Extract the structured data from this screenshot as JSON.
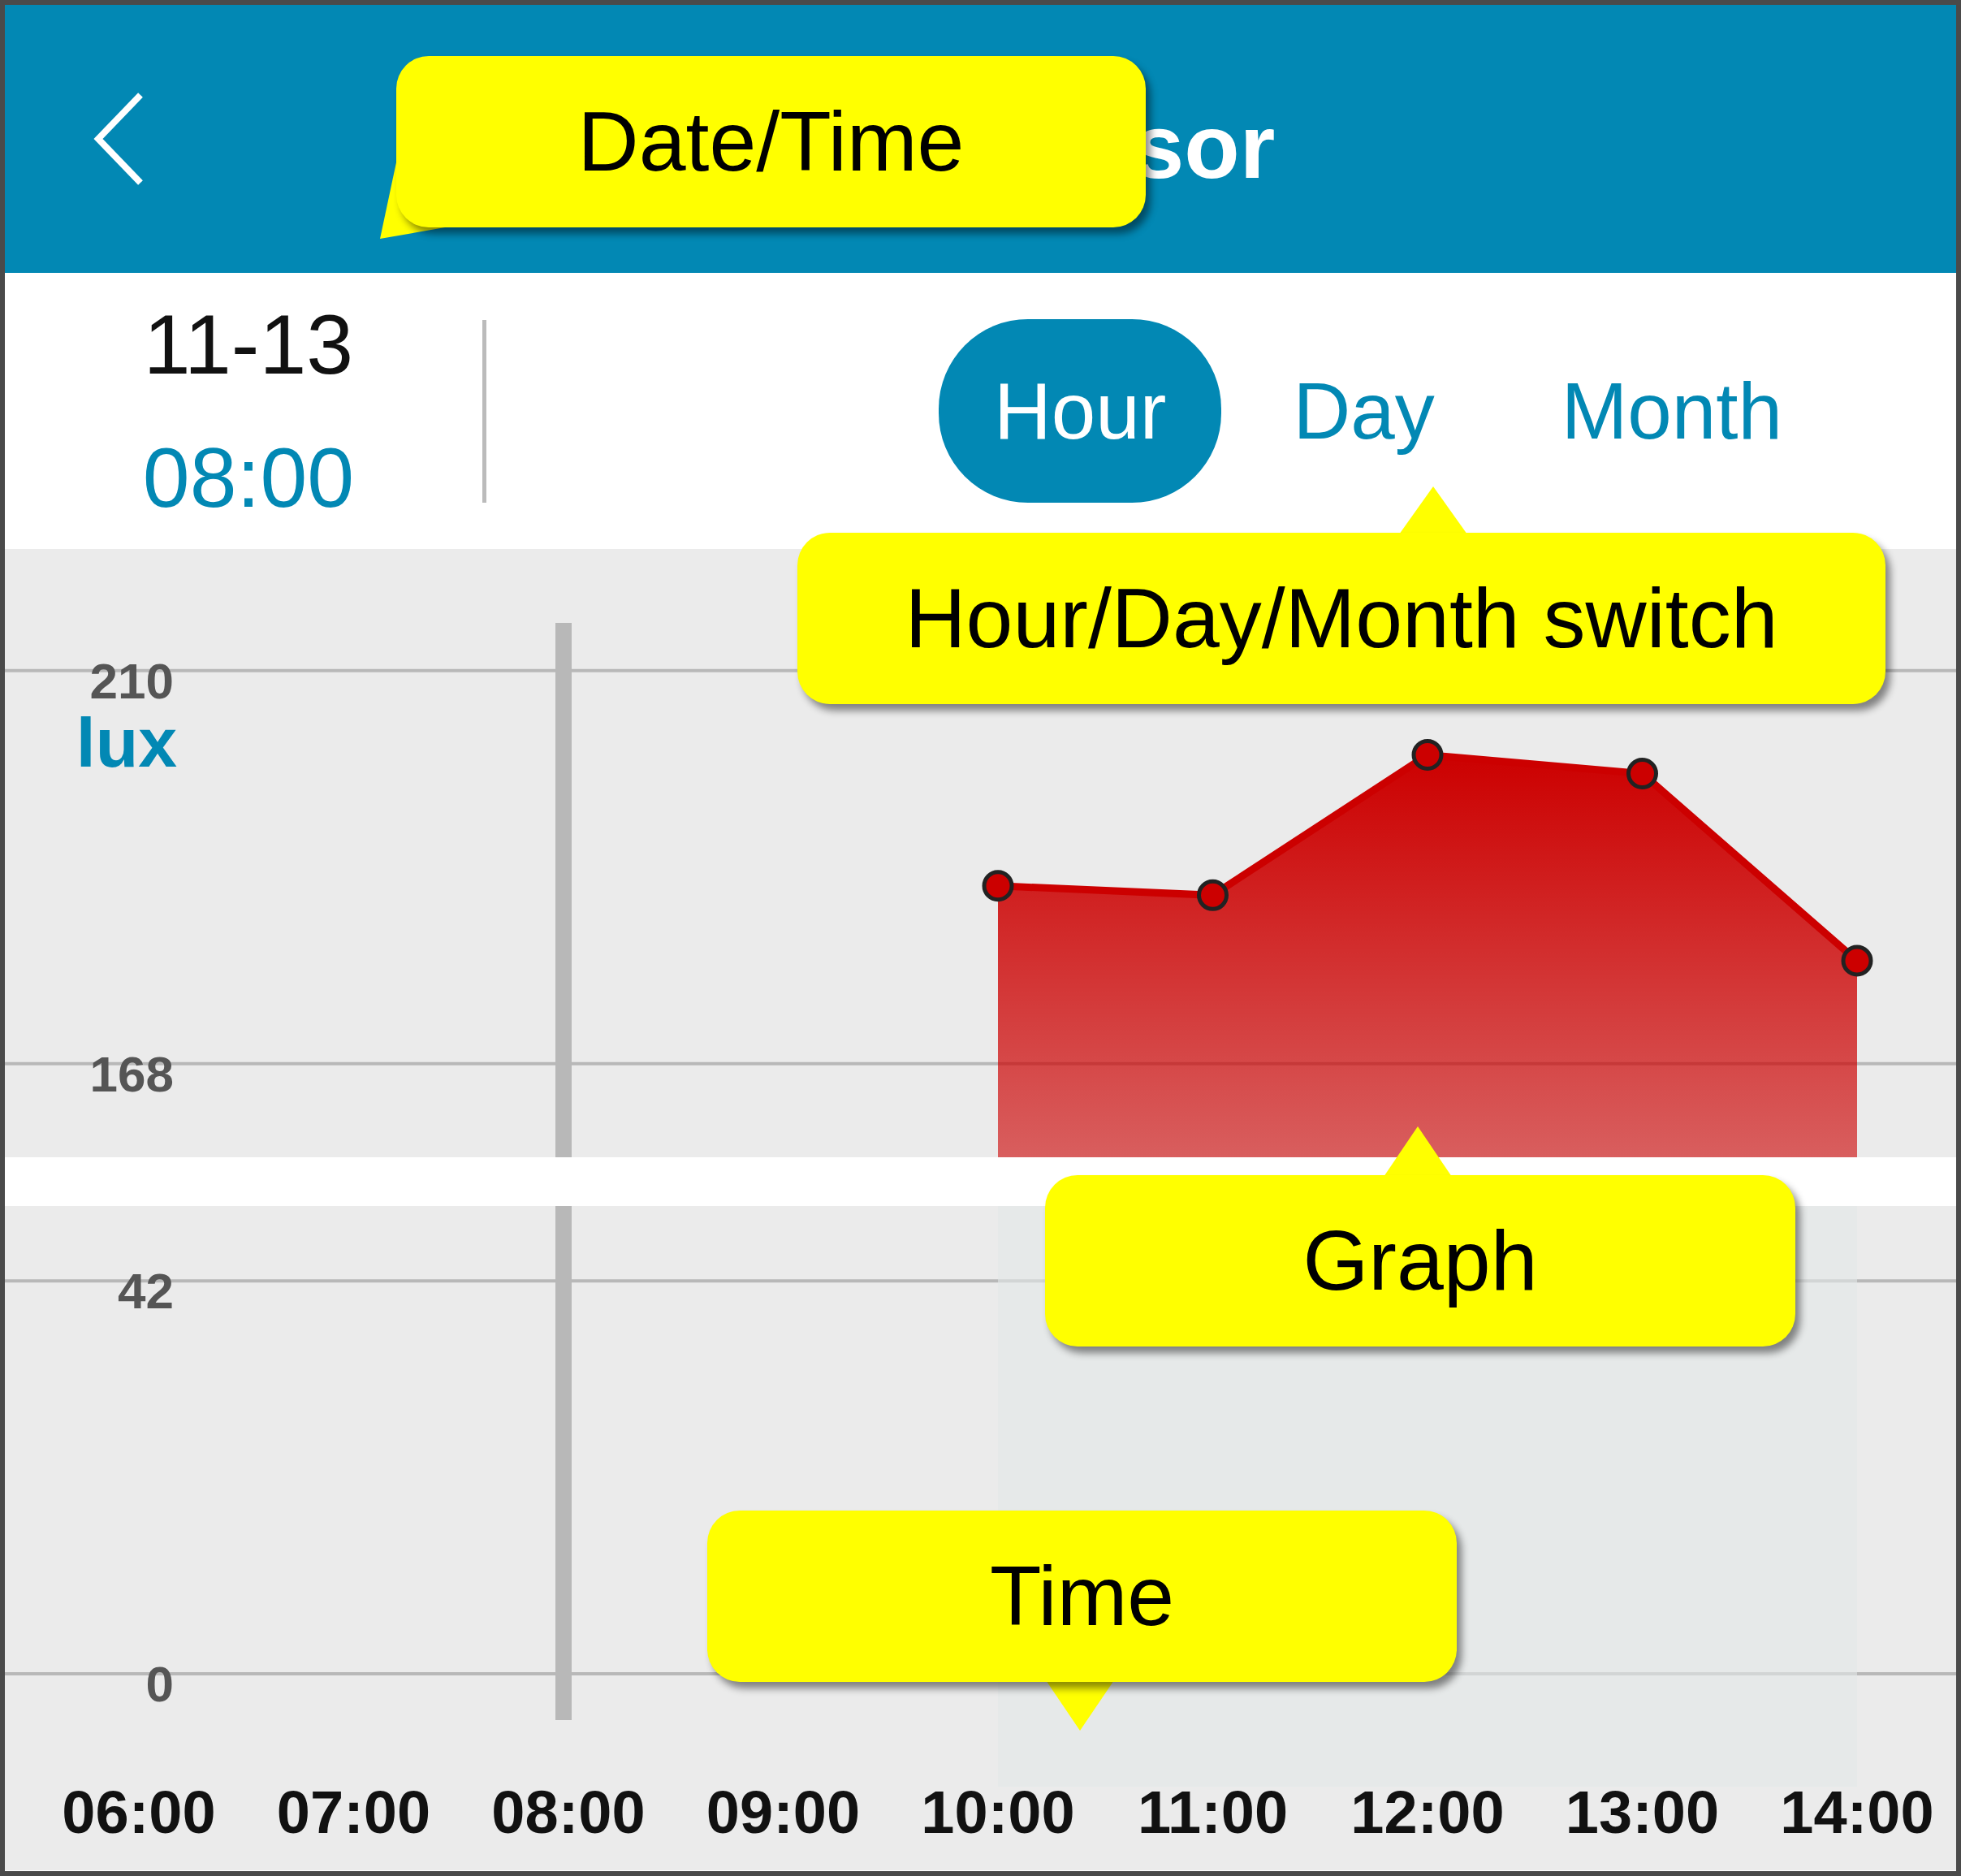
{
  "header": {
    "title": "sor"
  },
  "date": "11-13",
  "time": "08:00",
  "period_tabs": [
    {
      "label": "Hour",
      "selected": true
    },
    {
      "label": "Day",
      "selected": false
    },
    {
      "label": "Month",
      "selected": false
    }
  ],
  "chart_data": {
    "type": "area",
    "series": [
      {
        "name": "lux",
        "color": "#cc0000",
        "values": [
          null,
          null,
          null,
          null,
          187,
          186,
          201,
          199,
          179
        ]
      }
    ],
    "yticks": [
      168,
      210
    ],
    "ylim": [
      158,
      223
    ],
    "annotations": [
      {
        "x": "08:00"
      }
    ]
  },
  "lower_panel": {
    "chart_data": {
      "type": "area",
      "categories": [
        "06:00",
        "07:00",
        "08:00",
        "09:00",
        "10:00",
        "11:00",
        "12:00",
        "13:00",
        "14:00"
      ],
      "yticks": [
        0,
        42
      ],
      "ylim": [
        -21,
        50
      ],
      "annotations": [
        {
          "x": "08:00"
        }
      ]
    }
  },
  "callouts": [
    {
      "text": "Date/Time"
    },
    {
      "text": "Hour/Day/Month switch"
    },
    {
      "text": "Graph"
    },
    {
      "text": "Time"
    }
  ]
}
